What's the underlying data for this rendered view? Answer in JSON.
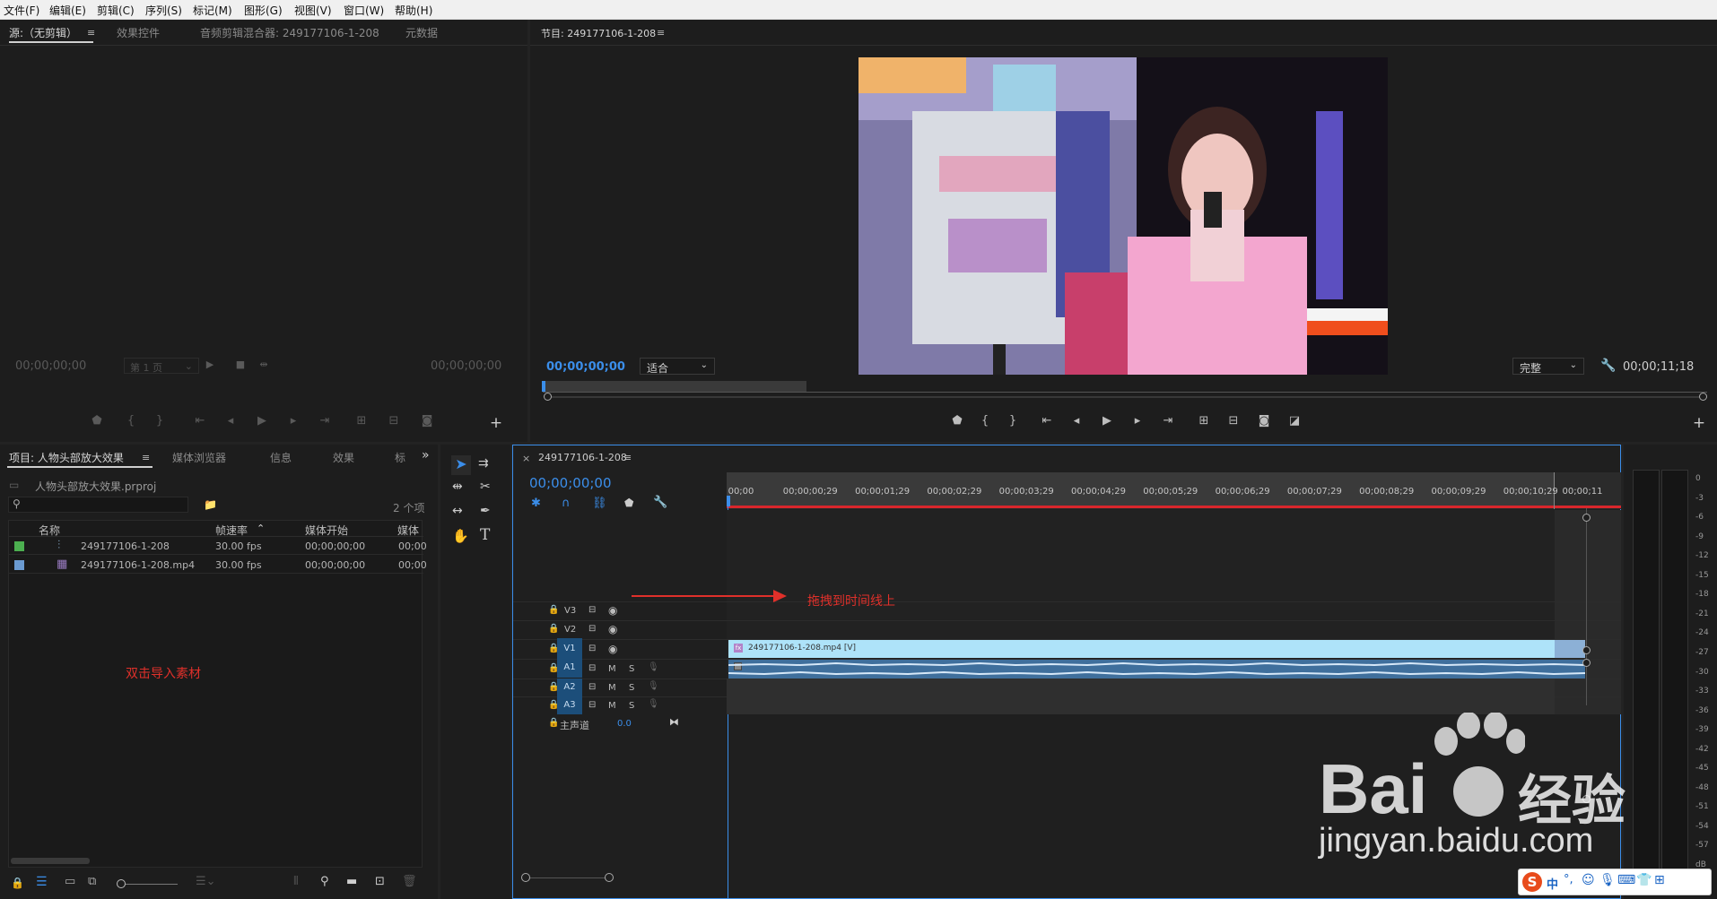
{
  "menu": [
    "文件(F)",
    "编辑(E)",
    "剪辑(C)",
    "序列(S)",
    "标记(M)",
    "图形(G)",
    "视图(V)",
    "窗口(W)",
    "帮助(H)"
  ],
  "source_panel": {
    "tabs": [
      "源:（无剪辑）",
      "效果控件",
      "音频剪辑混合器: 249177106-1-208",
      "元数据"
    ],
    "timecode_left": "00;00;00;00",
    "page_select": "第 1 页",
    "timecode_right": "00;00;00;00"
  },
  "program_panel": {
    "title": "节目: 249177106-1-208",
    "timecode": "00;00;00;00",
    "fit_select": "适合",
    "quality_select": "完整",
    "duration": "00;00;11;18"
  },
  "project_panel": {
    "tabs": [
      "项目: 人物头部放大效果",
      "媒体浏览器",
      "信息",
      "效果",
      "标"
    ],
    "file_name": "人物头部放大效果.prproj",
    "item_count": "2 个项",
    "columns": [
      "名称",
      "帧速率",
      "媒体开始",
      "媒体"
    ],
    "rows": [
      {
        "name": "249177106-1-208",
        "fps": "30.00 fps",
        "start": "00;00;00;00",
        "end": "00;00",
        "color": "#4caf50"
      },
      {
        "name": "249177106-1-208.mp4",
        "fps": "30.00 fps",
        "start": "00;00;00;00",
        "end": "00;00",
        "color": "#6b9bd1"
      }
    ],
    "annotation": "双击导入素材"
  },
  "timeline": {
    "tab": "249177106-1-208",
    "timecode": "00;00;00;00",
    "ruler": [
      "00;00",
      "00;00;00;29",
      "00;00;01;29",
      "00;00;02;29",
      "00;00;03;29",
      "00;00;04;29",
      "00;00;05;29",
      "00;00;06;29",
      "00;00;07;29",
      "00;00;08;29",
      "00;00;09;29",
      "00;00;10;29",
      "00;00;11"
    ],
    "video_tracks": [
      "V3",
      "V2",
      "V1"
    ],
    "audio_tracks": [
      "A1",
      "A2",
      "A3"
    ],
    "master_label": "主声道",
    "master_value": "0.0",
    "clip_label": "249177106-1-208.mp4 [V]",
    "annotation": "拖拽到时间线上",
    "m_label": "M",
    "s_label": "S"
  },
  "meter": {
    "scale": [
      "0",
      "-3",
      "-6",
      "-9",
      "-12",
      "-15",
      "-18",
      "-21",
      "-24",
      "-27",
      "-30",
      "-33",
      "-36",
      "-39",
      "-42",
      "-45",
      "-48",
      "-51",
      "-54",
      "-57",
      "dB"
    ]
  },
  "watermark": {
    "brand": "Bai",
    "brand_cn": "经验",
    "url": "jingyan.baidu.com"
  },
  "ime": {
    "label": "中"
  }
}
